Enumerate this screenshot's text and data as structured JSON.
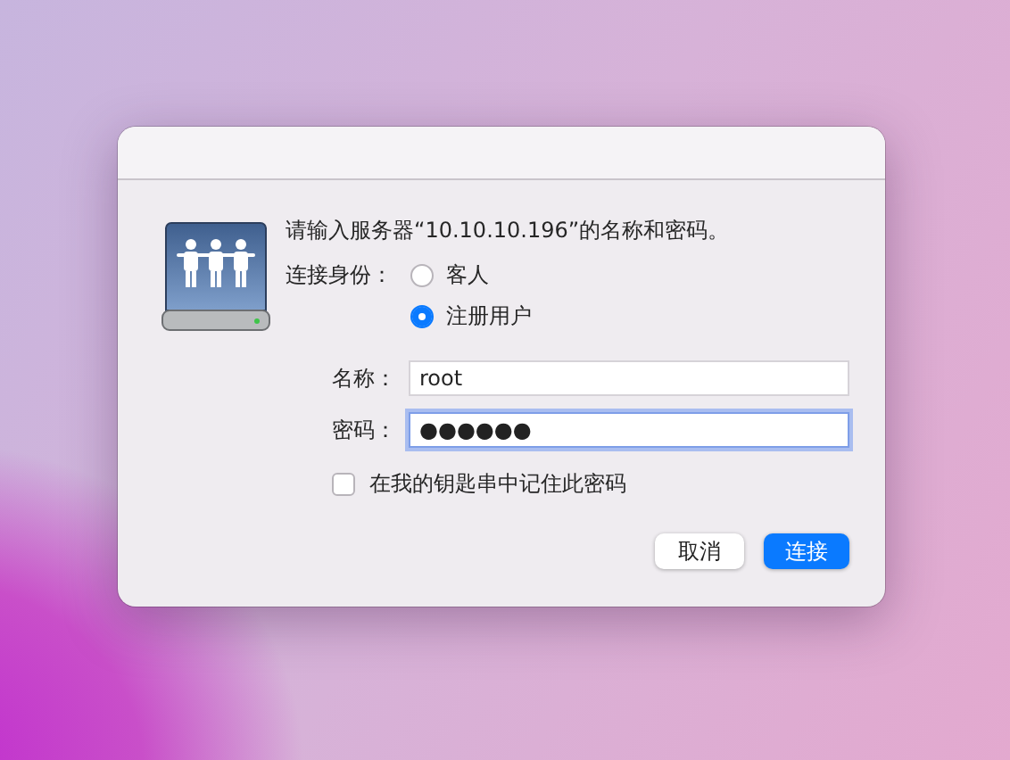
{
  "dialog": {
    "message": "请输入服务器“10.10.10.196”的名称和密码。",
    "connect_as": {
      "label": "连接身份：",
      "options": [
        {
          "label": "客人",
          "selected": false
        },
        {
          "label": "注册用户",
          "selected": true
        }
      ]
    },
    "fields": [
      {
        "label": "名称：",
        "value": "root",
        "focused": false
      },
      {
        "label": "密码：",
        "value": "●●●●●●",
        "focused": true
      }
    ],
    "remember": {
      "label": "在我的钥匙串中记住此密码",
      "checked": false
    },
    "buttons": [
      {
        "label": "取消",
        "kind": "secondary"
      },
      {
        "label": "连接",
        "kind": "primary"
      }
    ]
  }
}
